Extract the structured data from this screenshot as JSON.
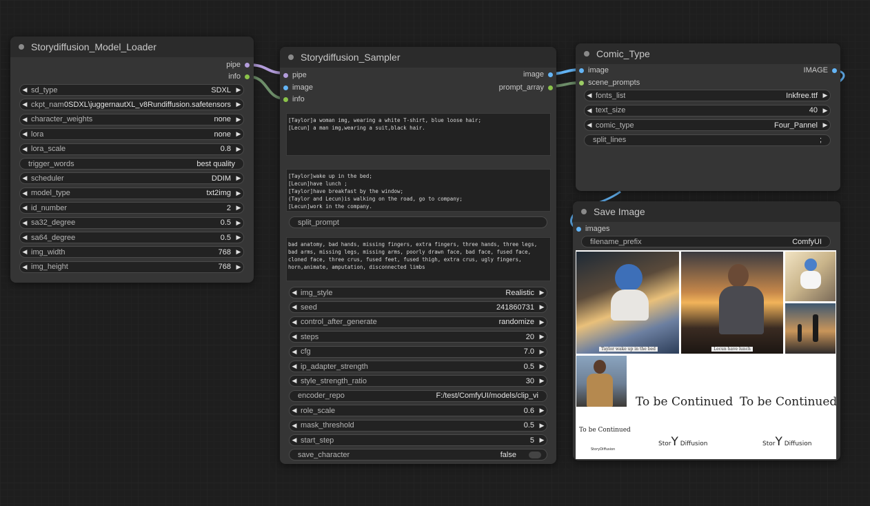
{
  "colors": {
    "canvas": "#1e1e1e",
    "node_bg": "#353535",
    "pipe": "#b39ddb",
    "info": "#8bc34a",
    "image": "#64b5f6",
    "scene": "#9ccc65"
  },
  "loader": {
    "title": "Storydiffusion_Model_Loader",
    "outputs": [
      "pipe",
      "info"
    ],
    "widgets": [
      {
        "label": "sd_type",
        "value": "SDXL",
        "arrows": true
      },
      {
        "label": "ckpt_name",
        "value": "0SDXL\\juggernautXL_v8Rundiffusion.safetensors",
        "arrows": true
      },
      {
        "label": "character_weights",
        "value": "none",
        "arrows": true
      },
      {
        "label": "lora",
        "value": "none",
        "arrows": true
      },
      {
        "label": "lora_scale",
        "value": "0.8",
        "arrows": true
      },
      {
        "label": "trigger_words",
        "value": "best quality",
        "arrows": false
      },
      {
        "label": "scheduler",
        "value": "DDIM",
        "arrows": true
      },
      {
        "label": "model_type",
        "value": "txt2img",
        "arrows": true
      },
      {
        "label": "id_number",
        "value": "2",
        "arrows": true
      },
      {
        "label": "sa32_degree",
        "value": "0.5",
        "arrows": true
      },
      {
        "label": "sa64_degree",
        "value": "0.5",
        "arrows": true
      },
      {
        "label": "img_width",
        "value": "768",
        "arrows": true
      },
      {
        "label": "img_height",
        "value": "768",
        "arrows": true
      }
    ]
  },
  "sampler": {
    "title": "Storydiffusion_Sampler",
    "inputs": [
      "pipe",
      "image",
      "info"
    ],
    "outputs": [
      "image",
      "prompt_array"
    ],
    "character_prompt": "[Taylor]a woman img, wearing a white T-shirt, blue loose hair;\n[Lecun] a man img,wearing a suit,black hair.",
    "scene_prompt": "[Taylor]wake up in the bed;\n[Lecun]have lunch ;\n[Taylor]have breakfast by the window;\n(Taylor and Lecun)is walking on the road, go to company;\n[Lecun]work in the company.",
    "split_prompt_label": "split_prompt",
    "negative_prompt": "bad anatomy, bad hands, missing fingers, extra fingers, three hands, three legs, bad arms, missing legs, missing arms, poorly drawn face, bad face, fused face, cloned face, three crus, fused feet, fused thigh, extra crus, ugly fingers, horn,animate, amputation, disconnected limbs",
    "widgets": [
      {
        "label": "img_style",
        "value": "Realistic",
        "arrows": true
      },
      {
        "label": "seed",
        "value": "241860731",
        "arrows": true
      },
      {
        "label": "control_after_generate",
        "value": "randomize",
        "arrows": true
      },
      {
        "label": "steps",
        "value": "20",
        "arrows": true
      },
      {
        "label": "cfg",
        "value": "7.0",
        "arrows": true
      },
      {
        "label": "ip_adapter_strength",
        "value": "0.5",
        "arrows": true
      },
      {
        "label": "style_strength_ratio",
        "value": "30",
        "arrows": true
      },
      {
        "label": "encoder_repo",
        "value": "F:/test/ComfyUI/models/clip_vi",
        "arrows": false
      },
      {
        "label": "role_scale",
        "value": "0.6",
        "arrows": true
      },
      {
        "label": "mask_threshold",
        "value": "0.5",
        "arrows": true
      },
      {
        "label": "start_step",
        "value": "5",
        "arrows": true
      },
      {
        "label": "save_character",
        "value": "false",
        "arrows": false
      }
    ]
  },
  "comic": {
    "title": "Comic_Type",
    "inputs": [
      "image",
      "scene_prompts"
    ],
    "output": "IMAGE",
    "widgets": [
      {
        "label": "fonts_list",
        "value": "Inkfree.ttf",
        "arrows": true
      },
      {
        "label": "text_size",
        "value": "40",
        "arrows": true
      },
      {
        "label": "comic_type",
        "value": "Four_Pannel",
        "arrows": true
      },
      {
        "label": "split_lines",
        "value": ";",
        "arrows": false
      }
    ]
  },
  "save": {
    "title": "Save Image",
    "input": "images",
    "prefix_label": "filename_prefix",
    "prefix_value": "ComfyUI",
    "captions": {
      "bed": "Taylor wake up in the bed",
      "lunch": "Lecun have lunch",
      "continued_small": "To be Continued",
      "continued_1": "To be Continued",
      "continued_2": "To be Continued",
      "logo_small": "StoryDiffusion",
      "logo_1_pre": "Stor",
      "logo_1_y": "Y",
      "logo_1_post": " Diffusion",
      "logo_2_pre": "Stor",
      "logo_2_y": "Y",
      "logo_2_post": " Diffusion"
    }
  }
}
